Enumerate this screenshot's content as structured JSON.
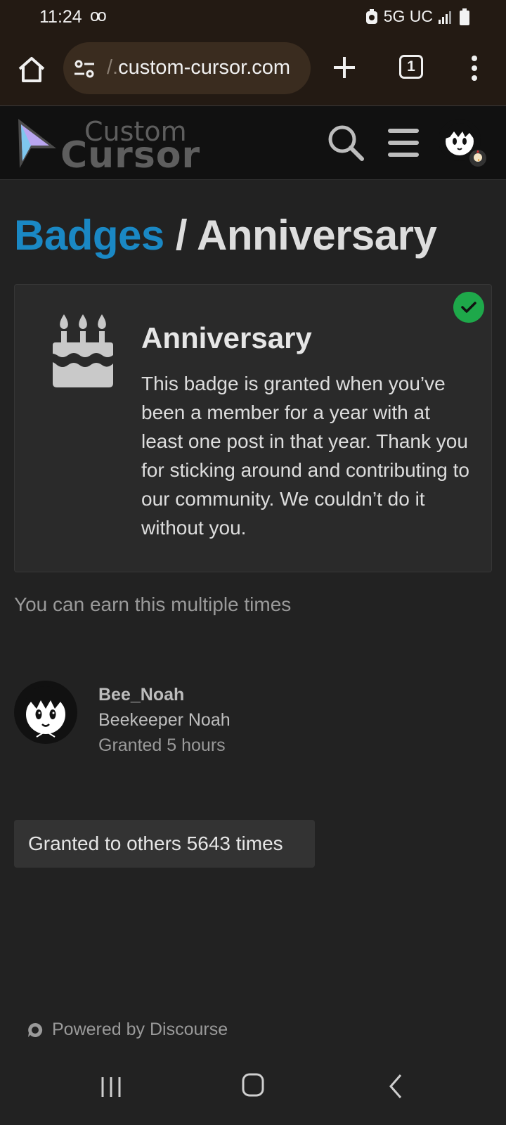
{
  "status_bar": {
    "time": "11:24",
    "left_indicator": "oo",
    "network": "5G UC",
    "icons": [
      "voicemail-icon",
      "alarm-icon",
      "signal-icon",
      "battery-icon"
    ]
  },
  "browser": {
    "url_prefix": "/.",
    "url": "custom-cursor.com",
    "tab_count": "1",
    "icons": [
      "home-icon",
      "site-settings-icon",
      "new-tab-icon",
      "tab-switcher-icon",
      "more-icon"
    ]
  },
  "site": {
    "logo_line1": "Custom",
    "logo_line2": "Cursor",
    "icons": [
      "search-icon",
      "hamburger-menu-icon",
      "user-avatar"
    ]
  },
  "breadcrumb": {
    "parent": "Badges",
    "separator": "/",
    "current": "Anniversary"
  },
  "badge": {
    "name": "Anniversary",
    "description": "This badge is granted when you’ve been a member for a year with at least one post in that year. Thank you for sticking around and contributing to our community. We couldn’t do it without you.",
    "icon": "birthday-cake-icon",
    "granted_check": "check-icon",
    "check_color": "#1ea84a"
  },
  "earn_note": "You can earn this multiple times",
  "grantee": {
    "username": "Bee_Noah",
    "title": "Beekeeper Noah",
    "granted": "Granted 5 hours"
  },
  "others_button": "Granted to others 5643 times",
  "footer": {
    "powered_by": "Powered by Discourse",
    "icon": "discourse-icon"
  },
  "colors": {
    "link_blue": "#1a88c4",
    "background": "#222222",
    "header_bg": "#111111",
    "browser_bg": "#231a13"
  },
  "android_nav": [
    "recents-icon",
    "home-circle-icon",
    "back-icon"
  ]
}
